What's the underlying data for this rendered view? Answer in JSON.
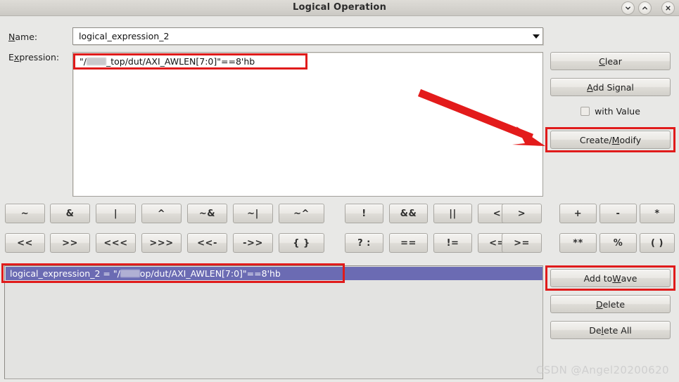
{
  "window": {
    "title": "Logical Operation",
    "controls": [
      {
        "name": "minimize",
        "glyph": "∨"
      },
      {
        "name": "maximize",
        "glyph": "∧"
      },
      {
        "name": "close",
        "glyph": "✕"
      }
    ]
  },
  "form": {
    "name_label": "Name:",
    "name_label_mnemonic": "N",
    "name_value": "logical_expression_2",
    "expression_label": "Expression:",
    "expression_label_mnemonic": "x",
    "expression_prefix": "\"/",
    "expression_suffix": "_top/dut/AXI_AWLEN[7:0]\"==8'hb",
    "expression_redacted": true
  },
  "actions": {
    "clear": {
      "pre": "",
      "mn": "C",
      "post": "lear"
    },
    "add_signal": {
      "pre": "",
      "mn": "A",
      "post": "dd Signal"
    },
    "with_value": {
      "pre": "with ",
      "mn": "V",
      "post": "alue"
    },
    "with_value_checked": false,
    "create_modify": {
      "pre": "Create/",
      "mn": "M",
      "post": "odify"
    }
  },
  "list_actions": {
    "add_to_wave": {
      "pre": "Add to ",
      "mn": "W",
      "post": "ave"
    },
    "delete": {
      "pre": "",
      "mn": "D",
      "post": "elete"
    },
    "delete_all": {
      "pre": "De",
      "mn": "l",
      "post": "ete All"
    }
  },
  "operators": {
    "group_left": [
      [
        "~",
        "&",
        "|",
        "^",
        "~&",
        "~|",
        "~^"
      ],
      [
        "<<",
        ">>",
        "<<<",
        ">>>",
        "<<-",
        "->>",
        "{ }"
      ]
    ],
    "group_middle": [
      [
        "!",
        "&&",
        "||",
        "<",
        ">"
      ],
      [
        "? :",
        "==",
        "!=",
        "<=",
        ">="
      ]
    ],
    "group_right": [
      [
        "+",
        "-",
        "*"
      ],
      [
        "**",
        "%",
        "( )"
      ]
    ]
  },
  "expression_list": {
    "rows": [
      {
        "prefix": "logical_expression_2 = \"/",
        "suffix": "op/dut/AXI_AWLEN[7:0]\"==8'hb",
        "redacted": true,
        "selected": true
      }
    ]
  },
  "annotations": {
    "watermark": "CSDN @Angel20200620",
    "highlight_color": "#e01b1b",
    "arrow_color": "#e31b1b",
    "selection_color": "#6b6bb3"
  }
}
